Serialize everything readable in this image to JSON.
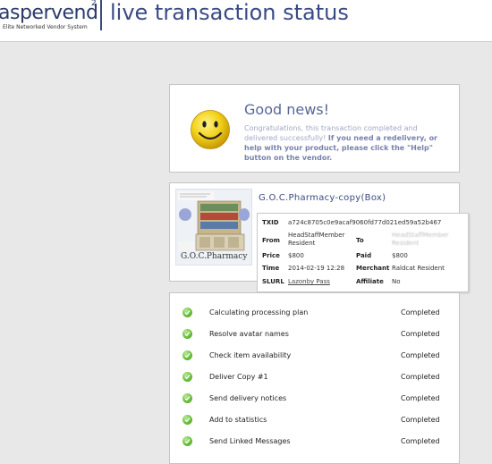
{
  "header": {
    "logo_text": "aspervend",
    "logo_sup": "2",
    "logo_tagline": "Elite Networked Vendor System",
    "title": "live transaction status"
  },
  "news": {
    "title": "Good news!",
    "body_plain": "Congratulations, this transaction completed and delivered successfully!",
    "body_bold": "If you need a redelivery, or help with your product, please click the \"Help\" button on the vendor."
  },
  "item": {
    "title": "G.O.C.Pharmacy-copy(Box)",
    "image_caption": "G.O.C.Pharmacy",
    "details": {
      "txid_label": "TXID",
      "txid": "a724c8705c0e9acaf9060fd77d021ed59a52b467",
      "from_label": "From",
      "from": "HeadStaffMember Resident",
      "to_label": "To",
      "to": "HeadStaffMember Resident",
      "price_label": "Price",
      "price": "$800",
      "paid_label": "Paid",
      "paid": "$800",
      "time_label": "Time",
      "time": "2014-02-19 12:28",
      "merchant_label": "Merchant",
      "merchant": "Raldcat Resident",
      "slurl_label": "SLURL",
      "slurl": "Lazonby Pass",
      "affiliate_label": "Affiliate",
      "affiliate": "No"
    }
  },
  "steps": [
    {
      "label": "Calculating processing plan",
      "status": "Completed"
    },
    {
      "label": "Resolve avatar names",
      "status": "Completed"
    },
    {
      "label": "Check item availability",
      "status": "Completed"
    },
    {
      "label": "Deliver Copy #1",
      "status": "Completed"
    },
    {
      "label": "Send delivery notices",
      "status": "Completed"
    },
    {
      "label": "Add to statistics",
      "status": "Completed"
    },
    {
      "label": "Send Linked Messages",
      "status": "Completed"
    }
  ],
  "colors": {
    "accent": "#3a4a85",
    "background": "#e8e8e8",
    "check_green": "#6cc03d",
    "smiley_yellow": "#f2d21a"
  },
  "icons": [
    "smiley-icon",
    "check-icon"
  ]
}
